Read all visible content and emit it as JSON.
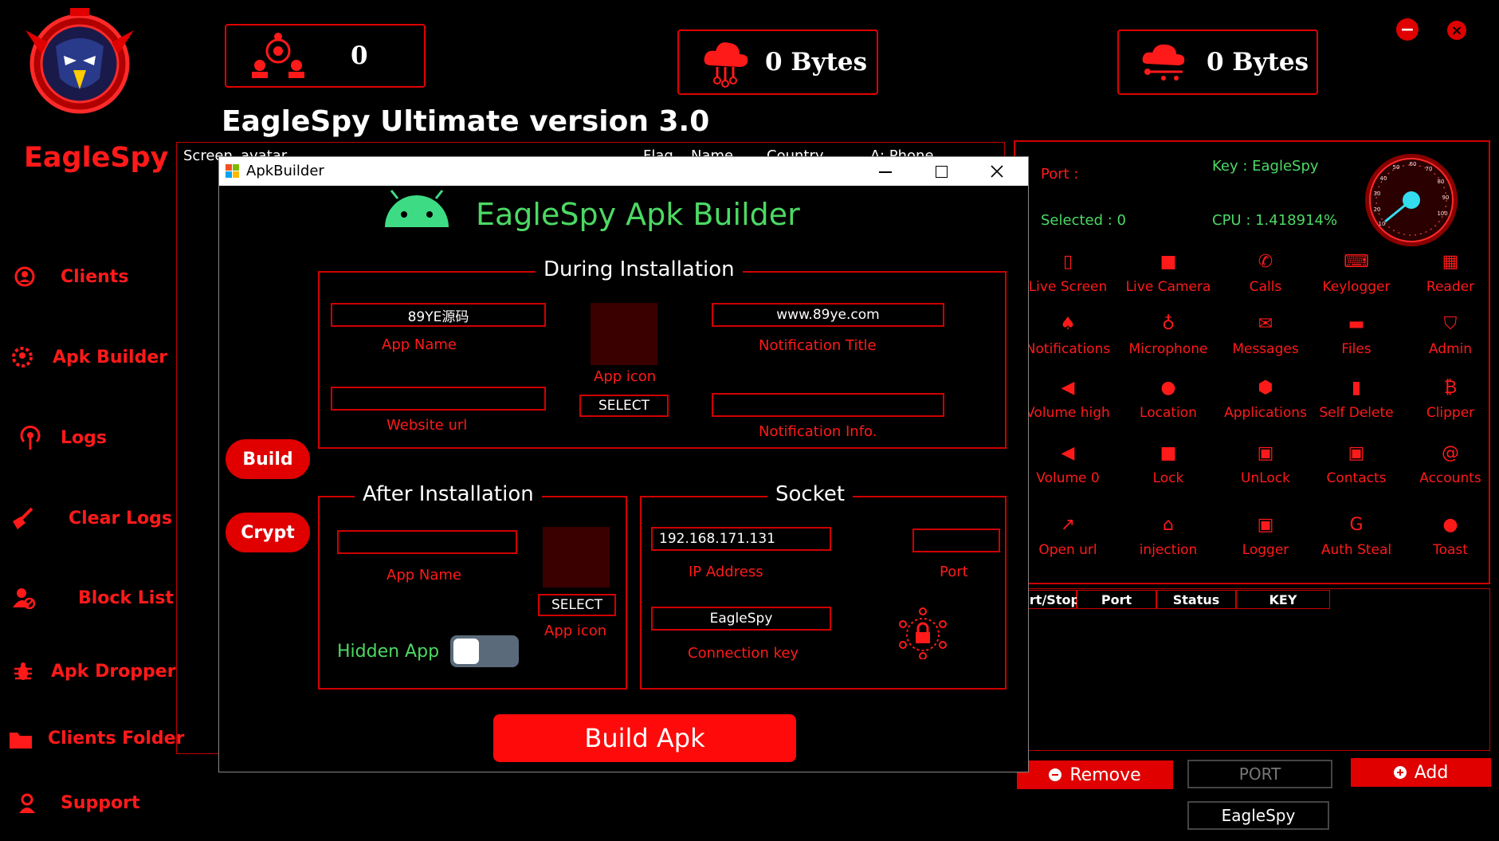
{
  "app": {
    "brand": "EagleSpy",
    "title": "EagleSpy Ultimate version 3.0"
  },
  "stats": {
    "clients_count": "0",
    "upload": "0 Bytes",
    "download": "0 Bytes"
  },
  "window_controls": {
    "minimize": "−",
    "close": "×"
  },
  "sidebar": {
    "items": [
      {
        "label": "Clients"
      },
      {
        "label": "Apk Builder"
      },
      {
        "label": "Logs"
      },
      {
        "label": "Clear Logs"
      },
      {
        "label": "Block List"
      },
      {
        "label": "Apk Dropper"
      },
      {
        "label": "Clients Folder"
      },
      {
        "label": "Support"
      }
    ]
  },
  "clients_table": {
    "headers": [
      "Screen",
      "avatar",
      "Flag",
      "Name",
      "Country",
      "A: Phone"
    ]
  },
  "right_panel": {
    "port_label": "Port :",
    "key_label": "Key : EagleSpy",
    "selected_label": "Selected : 0",
    "cpu_label": "CPU : 1.418914%",
    "gauge_ticks": [
      "10",
      "20",
      "30",
      "40",
      "50",
      "60",
      "70",
      "80",
      "90",
      "100"
    ],
    "tools": [
      {
        "label": "Live Screen",
        "icon": "phone-icon"
      },
      {
        "label": "Live Camera",
        "icon": "camera-icon"
      },
      {
        "label": "Calls",
        "icon": "call-icon"
      },
      {
        "label": "Keylogger",
        "icon": "keyboard-icon"
      },
      {
        "label": "Reader",
        "icon": "building-icon"
      },
      {
        "label": "Notifications",
        "icon": "bell-icon"
      },
      {
        "label": "Microphone",
        "icon": "mic-icon"
      },
      {
        "label": "Messages",
        "icon": "mail-icon"
      },
      {
        "label": "Files",
        "icon": "folder-icon"
      },
      {
        "label": "Admin",
        "icon": "shield-icon"
      },
      {
        "label": "Volume high",
        "icon": "volume-icon"
      },
      {
        "label": "Location",
        "icon": "pin-icon"
      },
      {
        "label": "Applications",
        "icon": "android-icon"
      },
      {
        "label": "Self Delete",
        "icon": "trash-icon"
      },
      {
        "label": "Clipper",
        "icon": "bitcoin-icon"
      },
      {
        "label": "Volume 0",
        "icon": "mute-icon"
      },
      {
        "label": "Lock",
        "icon": "lock-icon"
      },
      {
        "label": "UnLock",
        "icon": "unlock-icon"
      },
      {
        "label": "Contacts",
        "icon": "contacts-icon"
      },
      {
        "label": "Accounts",
        "icon": "at-icon"
      },
      {
        "label": "Open url",
        "icon": "external-link-icon"
      },
      {
        "label": "injection",
        "icon": "bank-icon"
      },
      {
        "label": "Logger",
        "icon": "logger-icon"
      },
      {
        "label": "Auth Steal",
        "icon": "google-icon"
      },
      {
        "label": "Toast",
        "icon": "chat-icon"
      }
    ],
    "ports_table_headers": [
      "art/Stop",
      "Port",
      "Status",
      "KEY"
    ],
    "remove_label": "Remove",
    "port_placeholder": "PORT",
    "add_label": "Add",
    "key_value": "EagleSpy"
  },
  "dialog": {
    "window_title": "ApkBuilder",
    "heading": "EagleSpy Apk Builder",
    "build_label": "Build",
    "crypt_label": "Crypt",
    "during": {
      "title": "During Installation",
      "app_name_value": "89YE源码",
      "app_name_label": "App Name",
      "website_url_value": "",
      "website_url_label": "Website url",
      "app_icon_label": "App icon",
      "select_label": "SELECT",
      "notification_title_value": "www.89ye.com",
      "notification_title_label": "Notification Title",
      "notification_info_value": "",
      "notification_info_label": "Notification Info."
    },
    "after": {
      "title": "After Installation",
      "app_name_value": "",
      "app_name_label": "App Name",
      "select_label": "SELECT",
      "app_icon_label": "App icon",
      "hidden_app_label": "Hidden App",
      "hidden_app_on": false
    },
    "socket": {
      "title": "Socket",
      "ip_value": "192.168.171.131",
      "ip_label": "IP Address",
      "port_value": "",
      "port_label": "Port",
      "key_value": "EagleSpy",
      "key_label": "Connection key"
    },
    "build_apk_label": "Build Apk"
  },
  "colors": {
    "accent": "#ff1a1a",
    "button": "#e00000",
    "success": "#4cd964",
    "background": "#000000"
  }
}
